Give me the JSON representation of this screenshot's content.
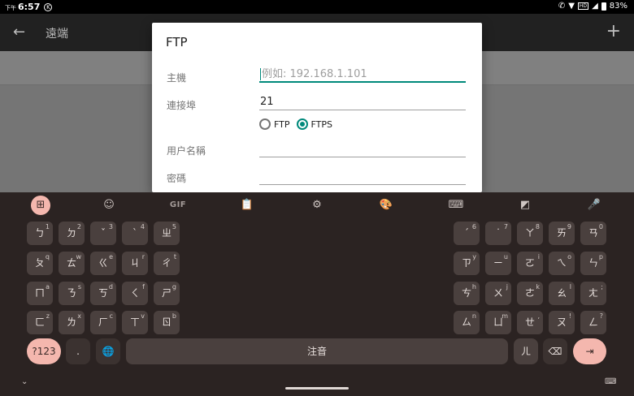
{
  "status": {
    "prefix": "下午",
    "time": "6:57",
    "kb_icon": "K",
    "right_text": "83%",
    "carrier_tag": "HD"
  },
  "appbar": {
    "title": "遠端",
    "back_glyph": "←",
    "add_glyph": "+"
  },
  "dialog": {
    "title": "FTP",
    "host_label": "主機",
    "host_placeholder": "例如: 192.168.1.101",
    "port_label": "連接埠",
    "port_value": "21",
    "protocols": [
      {
        "label": "FTP",
        "selected": false
      },
      {
        "label": "FTPS",
        "selected": true
      }
    ],
    "username_label": "用户名稱",
    "password_label": "密碼"
  },
  "accent_color": "#00897b",
  "keyboard": {
    "toolbar": [
      {
        "name": "apps-grid-icon",
        "glyph": "⊞",
        "active": true
      },
      {
        "name": "sticker-icon",
        "glyph": "☺",
        "active": false
      },
      {
        "name": "gif-icon",
        "glyph": "GIF",
        "active": false
      },
      {
        "name": "clipboard-icon",
        "glyph": "📋",
        "active": false
      },
      {
        "name": "settings-icon",
        "glyph": "⚙",
        "active": false
      },
      {
        "name": "palette-icon",
        "glyph": "🎨",
        "active": false
      },
      {
        "name": "keyboard-layout-icon",
        "glyph": "⌨",
        "active": false
      },
      {
        "name": "screenshot-icon",
        "glyph": "◩",
        "active": false
      },
      {
        "name": "microphone-icon",
        "glyph": "🎤",
        "active": false
      }
    ],
    "rows_left": [
      [
        {
          "m": "ㄅ",
          "s": "1"
        },
        {
          "m": "ㄉ",
          "s": "2"
        },
        {
          "m": "ˇ",
          "s": "3"
        },
        {
          "m": "ˋ",
          "s": "4"
        },
        {
          "m": "ㄓ",
          "s": "5"
        }
      ],
      [
        {
          "m": "ㄆ",
          "s": "q"
        },
        {
          "m": "ㄊ",
          "s": "w"
        },
        {
          "m": "ㄍ",
          "s": "e"
        },
        {
          "m": "ㄐ",
          "s": "r"
        },
        {
          "m": "ㄔ",
          "s": "t"
        }
      ],
      [
        {
          "m": "ㄇ",
          "s": "a"
        },
        {
          "m": "ㄋ",
          "s": "s"
        },
        {
          "m": "ㄎ",
          "s": "d"
        },
        {
          "m": "ㄑ",
          "s": "f"
        },
        {
          "m": "ㄕ",
          "s": "g"
        }
      ],
      [
        {
          "m": "ㄈ",
          "s": "z"
        },
        {
          "m": "ㄌ",
          "s": "x"
        },
        {
          "m": "ㄏ",
          "s": "c"
        },
        {
          "m": "ㄒ",
          "s": "v"
        },
        {
          "m": "ㄖ",
          "s": "b"
        }
      ]
    ],
    "rows_right": [
      [
        {
          "m": "ˊ",
          "s": "6"
        },
        {
          "m": "˙",
          "s": "7"
        },
        {
          "m": "ㄚ",
          "s": "8"
        },
        {
          "m": "ㄞ",
          "s": "9"
        },
        {
          "m": "ㄢ",
          "s": "0"
        }
      ],
      [
        {
          "m": "ㄗ",
          "s": "y"
        },
        {
          "m": "ㄧ",
          "s": "u"
        },
        {
          "m": "ㄛ",
          "s": "i"
        },
        {
          "m": "ㄟ",
          "s": "o"
        },
        {
          "m": "ㄣ",
          "s": "p"
        }
      ],
      [
        {
          "m": "ㄘ",
          "s": "h"
        },
        {
          "m": "ㄨ",
          "s": "j"
        },
        {
          "m": "ㄜ",
          "s": "k"
        },
        {
          "m": "ㄠ",
          "s": "l"
        },
        {
          "m": "ㄤ",
          "s": ";"
        }
      ],
      [
        {
          "m": "ㄙ",
          "s": "n"
        },
        {
          "m": "ㄩ",
          "s": "m"
        },
        {
          "m": "ㄝ",
          "s": ","
        },
        {
          "m": "ㄡ",
          "s": "!"
        },
        {
          "m": "ㄥ",
          "s": "?"
        }
      ]
    ],
    "bottom": {
      "symbols_label": "?123",
      "period_label": ".",
      "globe_glyph": "🌐",
      "space_label": "注音",
      "er_label": "ㄦ",
      "backspace_glyph": "⌫",
      "enter_glyph": "⇥"
    },
    "hide_glyph": "⌄",
    "switch_glyph": "⌨"
  }
}
